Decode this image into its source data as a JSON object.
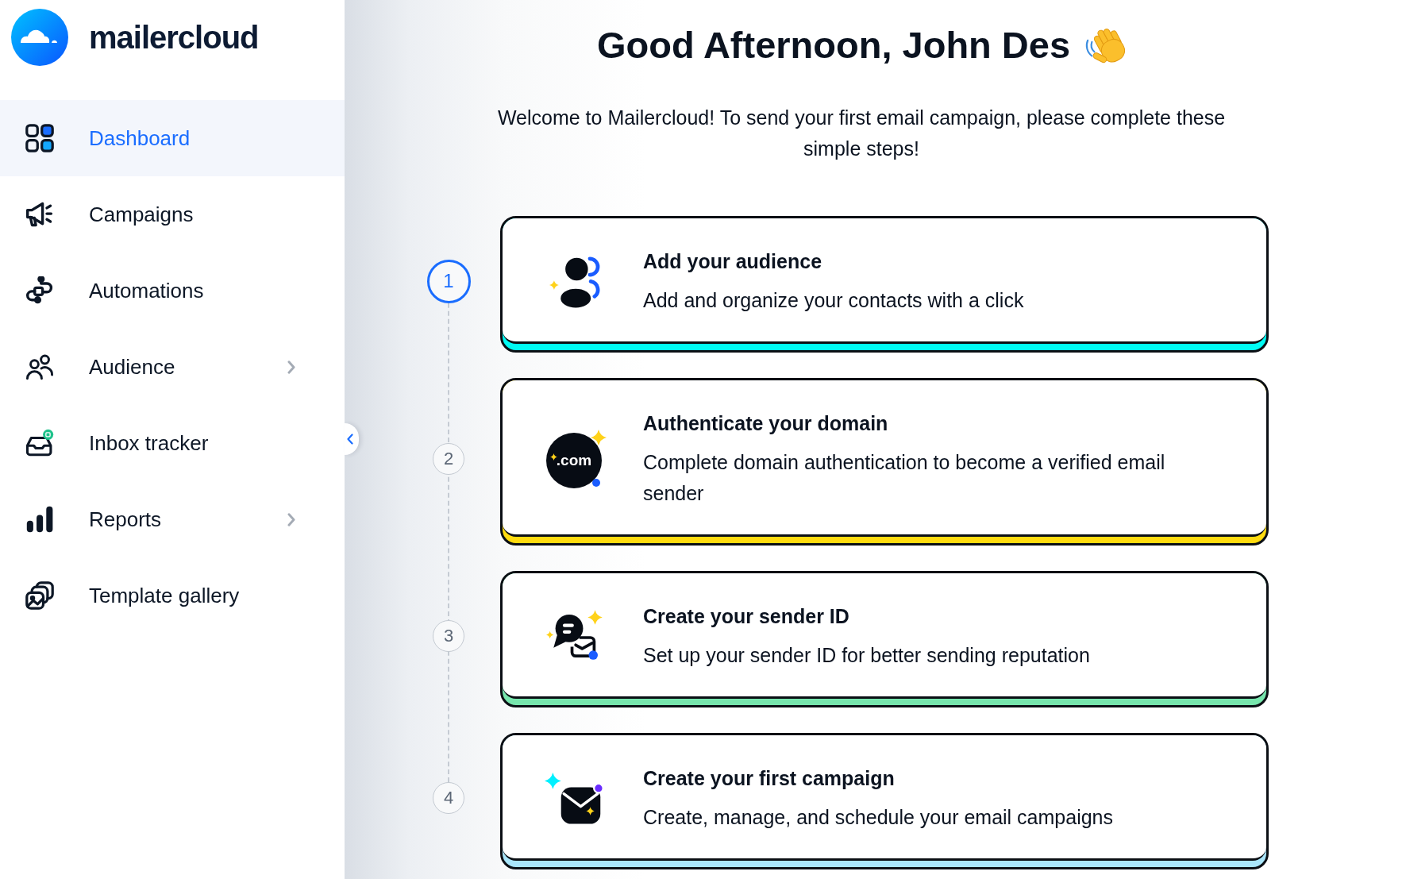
{
  "sidebar": {
    "brand": "mailercloud",
    "items": [
      {
        "label": "Dashboard",
        "selected": true,
        "expandable": false
      },
      {
        "label": "Campaigns",
        "selected": false,
        "expandable": false
      },
      {
        "label": "Automations",
        "selected": false,
        "expandable": false
      },
      {
        "label": "Audience",
        "selected": false,
        "expandable": true
      },
      {
        "label": "Inbox tracker",
        "selected": false,
        "expandable": false
      },
      {
        "label": "Reports",
        "selected": false,
        "expandable": true
      },
      {
        "label": "Template gallery",
        "selected": false,
        "expandable": false
      }
    ]
  },
  "greeting": {
    "title": "Good Afternoon, John Des",
    "subtitle": "Welcome to Mailercloud! To send your first email campaign, please complete these simple steps!"
  },
  "steps": [
    {
      "number": "1",
      "active": true,
      "title": "Add your audience",
      "description": "Add and organize your contacts with a click",
      "color": "#00fbf4"
    },
    {
      "number": "2",
      "active": false,
      "title": "Authenticate your domain",
      "description": "Complete domain authentication to become a verified email sender",
      "color": "#ffdb0f",
      "badge_text": ".com"
    },
    {
      "number": "3",
      "active": false,
      "title": "Create your sender ID",
      "description": "Set up your sender ID for better sending reputation",
      "color": "#77e6ad"
    },
    {
      "number": "4",
      "active": false,
      "title": "Create your first campaign",
      "description": "Create, manage, and schedule your email campaigns",
      "color": "#a9e6fb"
    }
  ]
}
